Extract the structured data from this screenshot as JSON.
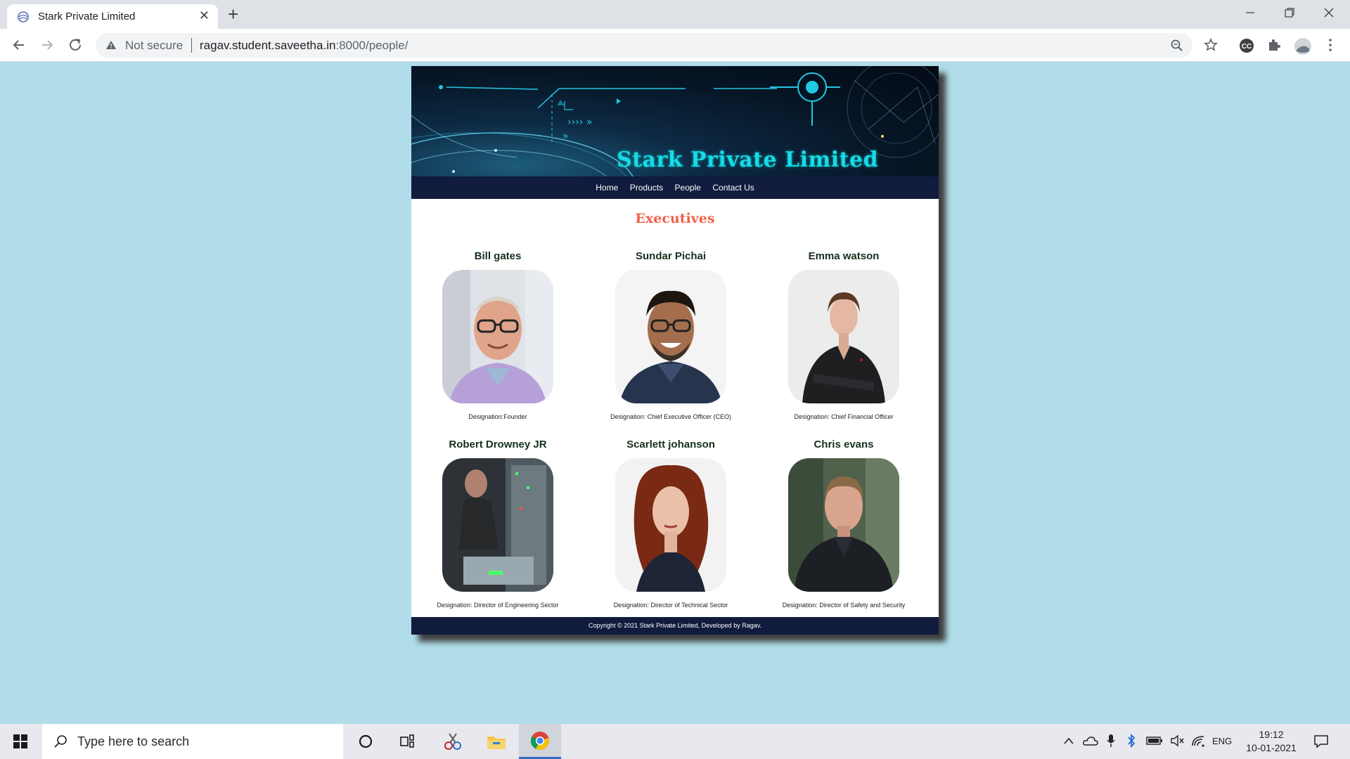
{
  "browser": {
    "tab_title": "Stark Private Limited",
    "tab_close": "✕",
    "new_tab": "+",
    "security_label": "Not secure",
    "url_host": "ragav.student.saveetha.in",
    "url_path": ":8000/people/"
  },
  "site": {
    "brand_title": "Stark Private Limited",
    "nav": [
      "Home",
      "Products",
      "People",
      "Contact Us"
    ],
    "section_title": "Executives",
    "people": [
      {
        "name": "Bill gates",
        "designation": "Designation:Founder"
      },
      {
        "name": "Sundar Pichai",
        "designation": "Designation: Chief Executive Officer (CEO)"
      },
      {
        "name": "Emma watson",
        "designation": "Designation: Chief Financial Officer"
      },
      {
        "name": "Robert Drowney JR",
        "designation": "Designation: Director of Engineering Sector"
      },
      {
        "name": "Scarlett johanson",
        "designation": "Designation: Director of Technical Sector"
      },
      {
        "name": "Chris evans",
        "designation": "Designation: Director of Safety and Security"
      }
    ],
    "footer": "Copyright © 2021 Stark Private Limited, Developed by Ragav."
  },
  "taskbar": {
    "search_placeholder": "Type here to search",
    "language": "ENG",
    "time": "19:12",
    "date": "10-01-2021"
  }
}
